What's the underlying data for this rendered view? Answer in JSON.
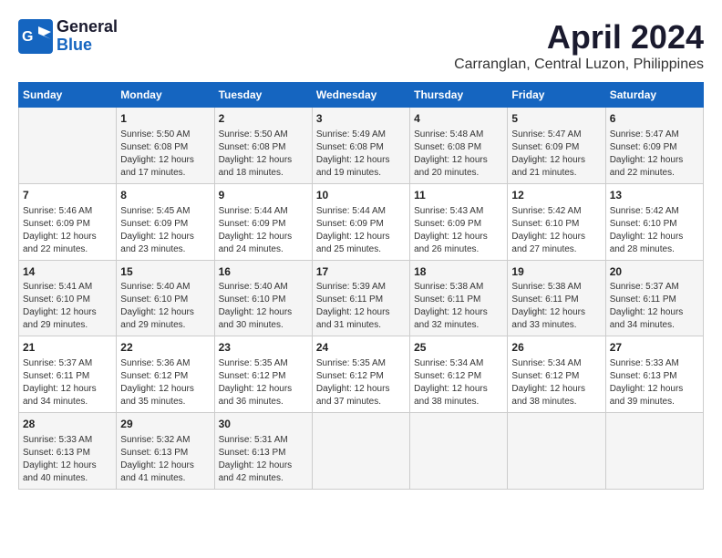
{
  "logo": {
    "line1": "General",
    "line2": "Blue"
  },
  "title": "April 2024",
  "subtitle": "Carranglan, Central Luzon, Philippines",
  "days_header": [
    "Sunday",
    "Monday",
    "Tuesday",
    "Wednesday",
    "Thursday",
    "Friday",
    "Saturday"
  ],
  "weeks": [
    [
      {
        "day": "",
        "info": ""
      },
      {
        "day": "1",
        "info": "Sunrise: 5:50 AM\nSunset: 6:08 PM\nDaylight: 12 hours\nand 17 minutes."
      },
      {
        "day": "2",
        "info": "Sunrise: 5:50 AM\nSunset: 6:08 PM\nDaylight: 12 hours\nand 18 minutes."
      },
      {
        "day": "3",
        "info": "Sunrise: 5:49 AM\nSunset: 6:08 PM\nDaylight: 12 hours\nand 19 minutes."
      },
      {
        "day": "4",
        "info": "Sunrise: 5:48 AM\nSunset: 6:08 PM\nDaylight: 12 hours\nand 20 minutes."
      },
      {
        "day": "5",
        "info": "Sunrise: 5:47 AM\nSunset: 6:09 PM\nDaylight: 12 hours\nand 21 minutes."
      },
      {
        "day": "6",
        "info": "Sunrise: 5:47 AM\nSunset: 6:09 PM\nDaylight: 12 hours\nand 22 minutes."
      }
    ],
    [
      {
        "day": "7",
        "info": "Sunrise: 5:46 AM\nSunset: 6:09 PM\nDaylight: 12 hours\nand 22 minutes."
      },
      {
        "day": "8",
        "info": "Sunrise: 5:45 AM\nSunset: 6:09 PM\nDaylight: 12 hours\nand 23 minutes."
      },
      {
        "day": "9",
        "info": "Sunrise: 5:44 AM\nSunset: 6:09 PM\nDaylight: 12 hours\nand 24 minutes."
      },
      {
        "day": "10",
        "info": "Sunrise: 5:44 AM\nSunset: 6:09 PM\nDaylight: 12 hours\nand 25 minutes."
      },
      {
        "day": "11",
        "info": "Sunrise: 5:43 AM\nSunset: 6:09 PM\nDaylight: 12 hours\nand 26 minutes."
      },
      {
        "day": "12",
        "info": "Sunrise: 5:42 AM\nSunset: 6:10 PM\nDaylight: 12 hours\nand 27 minutes."
      },
      {
        "day": "13",
        "info": "Sunrise: 5:42 AM\nSunset: 6:10 PM\nDaylight: 12 hours\nand 28 minutes."
      }
    ],
    [
      {
        "day": "14",
        "info": "Sunrise: 5:41 AM\nSunset: 6:10 PM\nDaylight: 12 hours\nand 29 minutes."
      },
      {
        "day": "15",
        "info": "Sunrise: 5:40 AM\nSunset: 6:10 PM\nDaylight: 12 hours\nand 29 minutes."
      },
      {
        "day": "16",
        "info": "Sunrise: 5:40 AM\nSunset: 6:10 PM\nDaylight: 12 hours\nand 30 minutes."
      },
      {
        "day": "17",
        "info": "Sunrise: 5:39 AM\nSunset: 6:11 PM\nDaylight: 12 hours\nand 31 minutes."
      },
      {
        "day": "18",
        "info": "Sunrise: 5:38 AM\nSunset: 6:11 PM\nDaylight: 12 hours\nand 32 minutes."
      },
      {
        "day": "19",
        "info": "Sunrise: 5:38 AM\nSunset: 6:11 PM\nDaylight: 12 hours\nand 33 minutes."
      },
      {
        "day": "20",
        "info": "Sunrise: 5:37 AM\nSunset: 6:11 PM\nDaylight: 12 hours\nand 34 minutes."
      }
    ],
    [
      {
        "day": "21",
        "info": "Sunrise: 5:37 AM\nSunset: 6:11 PM\nDaylight: 12 hours\nand 34 minutes."
      },
      {
        "day": "22",
        "info": "Sunrise: 5:36 AM\nSunset: 6:12 PM\nDaylight: 12 hours\nand 35 minutes."
      },
      {
        "day": "23",
        "info": "Sunrise: 5:35 AM\nSunset: 6:12 PM\nDaylight: 12 hours\nand 36 minutes."
      },
      {
        "day": "24",
        "info": "Sunrise: 5:35 AM\nSunset: 6:12 PM\nDaylight: 12 hours\nand 37 minutes."
      },
      {
        "day": "25",
        "info": "Sunrise: 5:34 AM\nSunset: 6:12 PM\nDaylight: 12 hours\nand 38 minutes."
      },
      {
        "day": "26",
        "info": "Sunrise: 5:34 AM\nSunset: 6:12 PM\nDaylight: 12 hours\nand 38 minutes."
      },
      {
        "day": "27",
        "info": "Sunrise: 5:33 AM\nSunset: 6:13 PM\nDaylight: 12 hours\nand 39 minutes."
      }
    ],
    [
      {
        "day": "28",
        "info": "Sunrise: 5:33 AM\nSunset: 6:13 PM\nDaylight: 12 hours\nand 40 minutes."
      },
      {
        "day": "29",
        "info": "Sunrise: 5:32 AM\nSunset: 6:13 PM\nDaylight: 12 hours\nand 41 minutes."
      },
      {
        "day": "30",
        "info": "Sunrise: 5:31 AM\nSunset: 6:13 PM\nDaylight: 12 hours\nand 42 minutes."
      },
      {
        "day": "",
        "info": ""
      },
      {
        "day": "",
        "info": ""
      },
      {
        "day": "",
        "info": ""
      },
      {
        "day": "",
        "info": ""
      }
    ]
  ]
}
